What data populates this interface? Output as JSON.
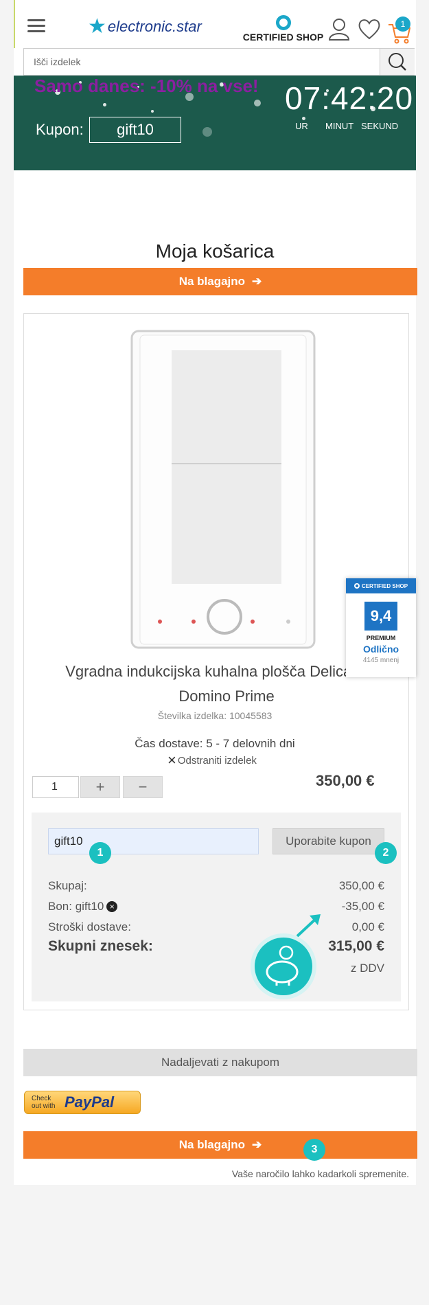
{
  "header": {
    "logo_text": "electronic.star",
    "certified_label": "CERTIFIED SHOP",
    "cart_count": "1"
  },
  "search": {
    "placeholder": "Išči izdelek"
  },
  "banner": {
    "title": "Samo danes: -10% na vse!",
    "coupon_label": "Kupon:",
    "coupon_code": "gift10",
    "timer": "07:42:20",
    "unit_hours": "UR",
    "unit_minutes": "MINUT",
    "unit_seconds": "SEKUND"
  },
  "cart": {
    "title": "Moja košarica",
    "checkout_label": "Na blagajno",
    "product": {
      "name": "Vgradna indukcijska kuhalna plošča Delicatessa Domino Prime",
      "sku": "Številka izdelka: 10045583",
      "delivery": "Čas dostave: 5 - 7 delovnih dni",
      "remove_label": "Odstraniti izdelek",
      "quantity": "1",
      "plus": "+",
      "minus": "−",
      "price": "350,00 €"
    },
    "coupon": {
      "value": "gift10",
      "apply_label": "Uporabite kupon"
    },
    "summary": {
      "subtotal_label": "Skupaj:",
      "subtotal_value": "350,00 €",
      "voucher_label": "Bon: gift10",
      "voucher_value": "-35,00 €",
      "shipping_label": "Stroški dostave:",
      "shipping_value": "0,00 €",
      "total_label": "Skupni znesek:",
      "total_value": "315,00 €",
      "vat_note": "z DDV"
    },
    "continue_label": "Nadaljevati z nakupom",
    "paypal_checkout": "Check out with",
    "paypal_logo": "PayPal",
    "note": "Vaše naročilo lahko kadarkoli spremenite."
  },
  "steps": [
    "1",
    "2",
    "3"
  ],
  "rating_widget": {
    "header": "CERTIFIED SHOP",
    "score": "9,4",
    "label": "PREMIUM",
    "word": "Odlično",
    "count": "4145 mnenj"
  },
  "colors": {
    "accent_orange": "#f47d2a",
    "banner_green": "#1c5a4c",
    "brand_blue": "#1e74c4",
    "step_teal": "#1bc0c0"
  }
}
